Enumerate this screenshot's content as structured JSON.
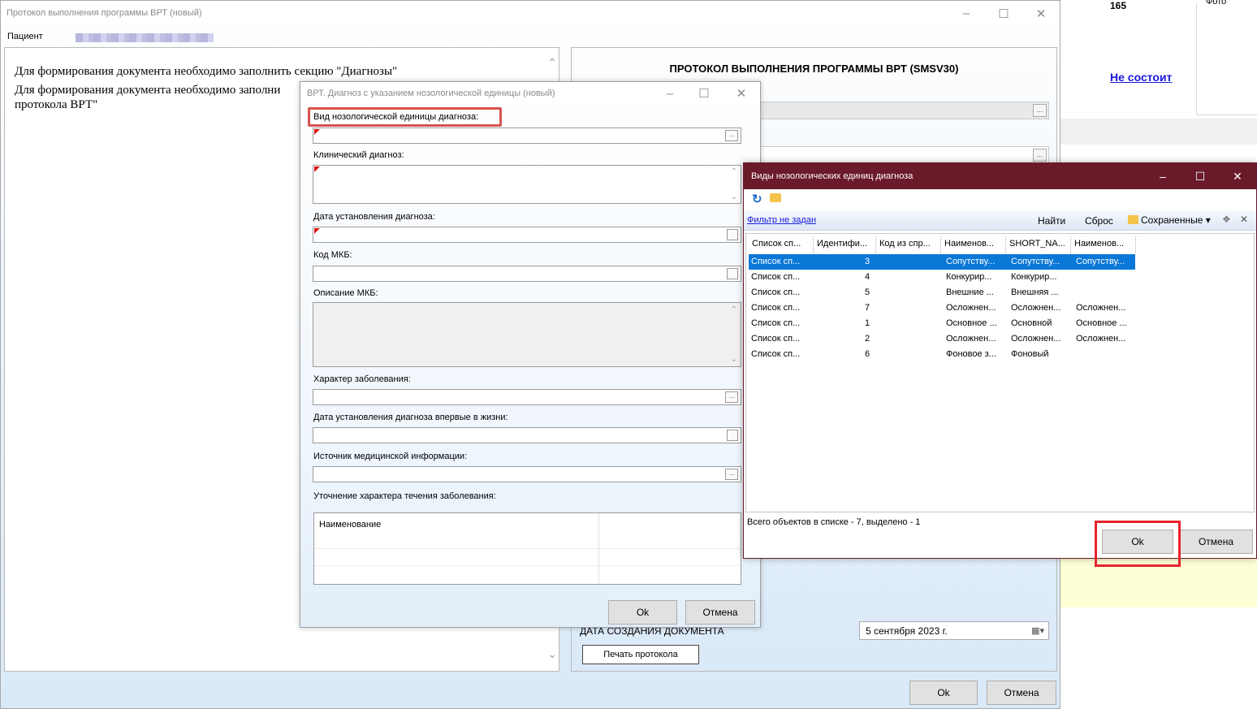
{
  "background": {
    "number": "165",
    "photo_label": "Фото",
    "status_link": "Не состоит"
  },
  "main": {
    "title": "Протокол выполнения программы ВРТ (новый)",
    "patient_label": "Пациент",
    "messages": [
      "Для формирования документа необходимо заполнить секцию \"Диагнозы\"",
      "Для формирования документа необходимо заполни",
      "протокола ВРТ\""
    ],
    "protocol_heading": "ПРОТОКОЛ ВЫПОЛНЕНИЯ ПРОГРАММЫ ВРТ (SMSV30)",
    "doc_date_label": "ДАТА СОЗДАНИЯ ДОКУМЕНТА",
    "doc_date_value": "5 сентября 2023 г.",
    "print_button": "Печать протокола",
    "ok_button": "Ok",
    "cancel_button": "Отмена"
  },
  "diag": {
    "title": "ВРТ. Диагноз с указанием нозологической единицы (новый)",
    "labels": {
      "vid": "Вид нозологической единицы диагноза:",
      "clinical": "Клинический диагноз:",
      "date": "Дата установления диагноза:",
      "mkb": "Код МКБ:",
      "mkb_desc": "Описание МКБ:",
      "character": "Характер заболевания:",
      "first_date": "Дата установления диагноза впервые в жизни:",
      "source": "Источник медицинской информации:",
      "spec": "Уточнение характера течения заболевания:"
    },
    "spec_column": "Наименование",
    "ok_button": "Ok",
    "cancel_button": "Отмена"
  },
  "list": {
    "title": "Виды нозологических единиц диагноза",
    "filter_link": "Фильтр не задан",
    "find": "Найти",
    "reset": "Сброс",
    "saved": "Сохраненные",
    "columns": [
      "Список сп...",
      "Идентифи...",
      "Код из спр...",
      "Наименов...",
      "SHORT_NA...",
      "Наименов..."
    ],
    "rows": [
      {
        "c1": "Список сп...",
        "c2": "3",
        "c3": "",
        "c4": "Сопутству...",
        "c5": "Сопутству...",
        "c6": "Сопутству..."
      },
      {
        "c1": "Список сп...",
        "c2": "4",
        "c3": "",
        "c4": "Конкурир...",
        "c5": "Конкурир...",
        "c6": ""
      },
      {
        "c1": "Список сп...",
        "c2": "5",
        "c3": "",
        "c4": "Внешние ...",
        "c5": "Внешняя ...",
        "c6": ""
      },
      {
        "c1": "Список сп...",
        "c2": "7",
        "c3": "",
        "c4": "Осложнен...",
        "c5": "Осложнен...",
        "c6": "Осложнен..."
      },
      {
        "c1": "Список сп...",
        "c2": "1",
        "c3": "",
        "c4": "Основное ...",
        "c5": "Основной",
        "c6": "Основное ..."
      },
      {
        "c1": "Список сп...",
        "c2": "2",
        "c3": "",
        "c4": "Осложнен...",
        "c5": "Осложнен...",
        "c6": "Осложнен..."
      },
      {
        "c1": "Список сп...",
        "c2": "6",
        "c3": "",
        "c4": "Фоновое з...",
        "c5": "Фоновый",
        "c6": ""
      }
    ],
    "status": "Всего объектов в списке - 7, выделено - 1",
    "ok_button": "Ok",
    "cancel_button": "Отмена"
  }
}
